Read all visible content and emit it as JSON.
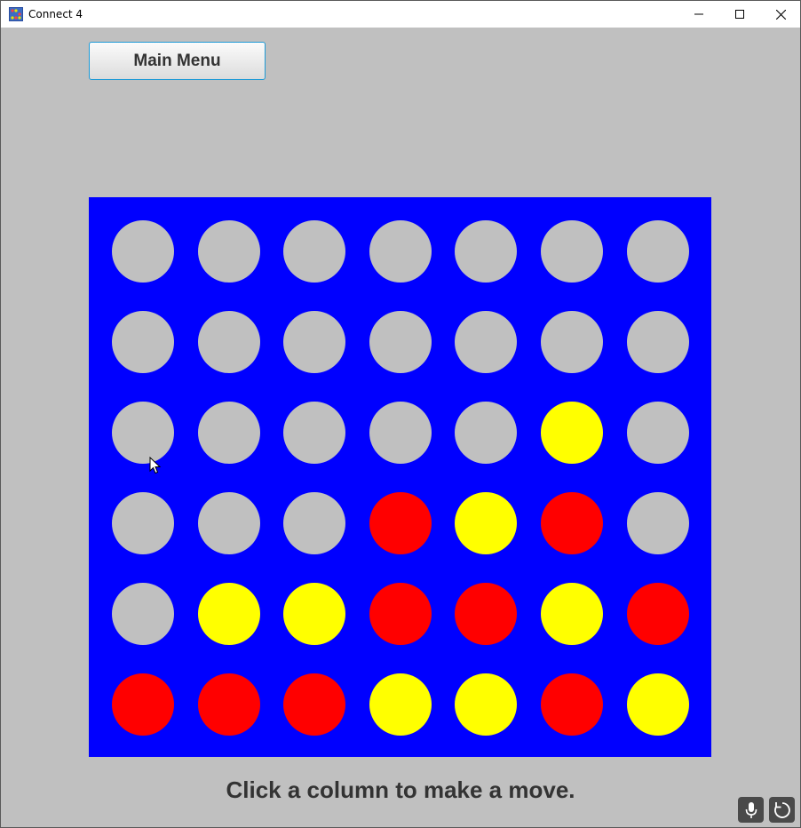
{
  "window": {
    "title": "Connect 4"
  },
  "toolbar": {
    "main_menu_label": "Main Menu"
  },
  "board": {
    "columns": 7,
    "rows": 6,
    "cells": [
      [
        "empty",
        "empty",
        "empty",
        "empty",
        "empty",
        "empty",
        "empty"
      ],
      [
        "empty",
        "empty",
        "empty",
        "empty",
        "empty",
        "empty",
        "empty"
      ],
      [
        "empty",
        "empty",
        "empty",
        "empty",
        "empty",
        "yellow",
        "empty"
      ],
      [
        "empty",
        "empty",
        "empty",
        "red",
        "yellow",
        "red",
        "empty"
      ],
      [
        "empty",
        "yellow",
        "yellow",
        "red",
        "red",
        "yellow",
        "red"
      ],
      [
        "red",
        "red",
        "red",
        "yellow",
        "yellow",
        "red",
        "yellow"
      ]
    ]
  },
  "status_text": "Click a column to make a move.",
  "colors": {
    "board": "#0000ff",
    "empty": "#c0c0c0",
    "red": "#ff0000",
    "yellow": "#ffff00",
    "background": "#c0c0c0"
  },
  "icons": {
    "app": "connect4-app-icon",
    "minimize": "minimize-icon",
    "maximize": "maximize-icon",
    "close": "close-icon",
    "mic": "microphone-icon",
    "refresh": "refresh-icon"
  }
}
